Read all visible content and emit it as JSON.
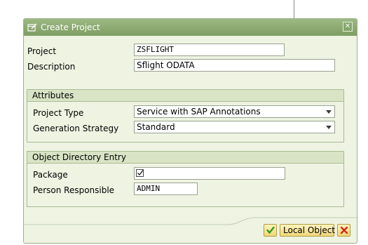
{
  "dialog": {
    "title": "Create Project",
    "close_symbol": "✕"
  },
  "fields": {
    "project_label": "Project",
    "project_value": "ZSFLIGHT",
    "description_label": "Description",
    "description_value": "Sflight ODATA"
  },
  "attributes": {
    "title": "Attributes",
    "project_type_label": "Project Type",
    "project_type_value": "Service with SAP Annotations",
    "generation_strategy_label": "Generation Strategy",
    "generation_strategy_value": "Standard"
  },
  "object_directory": {
    "title": "Object Directory Entry",
    "package_label": "Package",
    "package_checked": true,
    "person_label": "Person Responsible",
    "person_value": "ADMIN"
  },
  "footer": {
    "local_object_label": "Local Object"
  },
  "colors": {
    "titlebar": "#8aab6f",
    "dialog_bg": "#eef3e2",
    "section_header": "#d8e4c5",
    "button": "#f5e08e"
  },
  "icons": {
    "title": "edit-window-icon",
    "confirm": "green-check-icon",
    "cancel": "red-x-icon",
    "package_field": "checkbox-icon"
  }
}
